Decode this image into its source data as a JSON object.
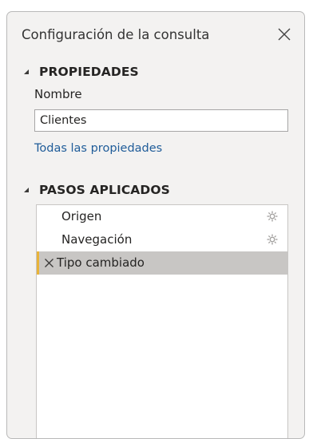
{
  "panel": {
    "title": "Configuración de la consulta"
  },
  "properties": {
    "section_title": "PROPIEDADES",
    "name_label": "Nombre",
    "name_value": "Clientes",
    "all_properties_link": "Todas las propiedades"
  },
  "applied_steps": {
    "section_title": "PASOS APLICADOS",
    "steps": [
      {
        "label": "Origen",
        "has_settings": true,
        "selected": false
      },
      {
        "label": "Navegación",
        "has_settings": true,
        "selected": false
      },
      {
        "label": "Tipo cambiado",
        "has_settings": false,
        "selected": true
      }
    ]
  },
  "icons": {
    "close": "close-icon",
    "collapse": "caret-down-icon",
    "settings": "gear-icon",
    "delete": "delete-x-icon"
  },
  "colors": {
    "pane_background": "#f3f2f1",
    "link": "#1f5c99",
    "selected_step_background": "#c8c6c4",
    "selected_step_accent": "#e8b339"
  }
}
